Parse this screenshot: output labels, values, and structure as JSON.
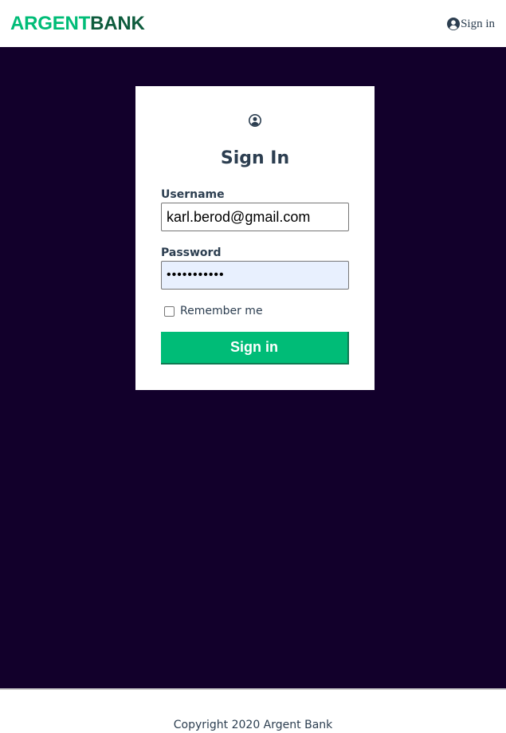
{
  "header": {
    "logo_part1": "ARGENT",
    "logo_part2": "BANK",
    "nav_signin_label": "Sign in",
    "nav_signin_icon": "user-circle-icon"
  },
  "form": {
    "header_icon": "user-circle-icon",
    "title": "Sign In",
    "username_label": "Username",
    "username_value": "karl.berod@gmail.com",
    "password_label": "Password",
    "password_mask": "•••••••••••",
    "remember_label": "Remember me",
    "remember_checked": false,
    "submit_label": "Sign in"
  },
  "footer": {
    "copyright": "Copyright 2020 Argent Bank"
  },
  "colors": {
    "brand_green": "#00bc77",
    "brand_dark_green": "#0e5c3d",
    "background_dark": "#12002b",
    "text": "#2c3e50",
    "password_autofill_bg": "#e8f0fe"
  }
}
